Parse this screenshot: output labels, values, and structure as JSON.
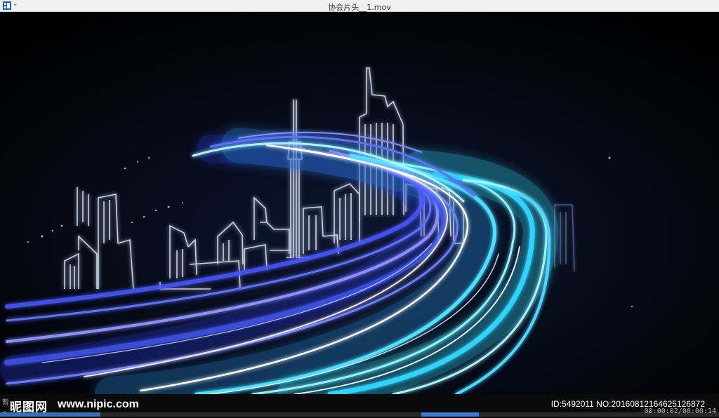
{
  "window": {
    "title": "协会片头__1.mov",
    "app_icon": "film-strip-icon",
    "menu_chevron": "⌄"
  },
  "video": {
    "scene": "neon city skyline with light trails"
  },
  "overlay": {
    "pause_label": "暂",
    "watermark_logo": "昵图网",
    "watermark_url": "www.nipic.com",
    "image_id": "ID:5492011 NO:20160812164625126872"
  },
  "player": {
    "rewind": "«",
    "forward": "»",
    "time": "00:00:02/00:00:14",
    "progress": 0.14
  },
  "colors": {
    "accent": "#3a6fb0",
    "neon_cyan": "#7fe8ff",
    "neon_blue": "#3b52e0"
  }
}
